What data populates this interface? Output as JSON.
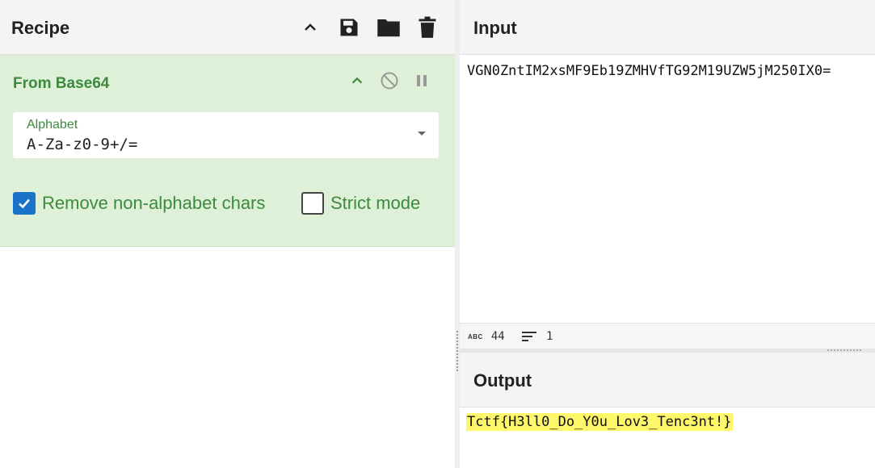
{
  "recipe": {
    "title": "Recipe",
    "buttons": {
      "collapse": "chevron-up-icon",
      "save": "save-icon",
      "load": "folder-icon",
      "clear": "trash-icon"
    }
  },
  "operation": {
    "title": "From Base64",
    "alphabet_label": "Alphabet",
    "alphabet_value": "A-Za-z0-9+/=",
    "remove_non_alphabet": {
      "label": "Remove non-alphabet chars",
      "checked": true
    },
    "strict_mode": {
      "label": "Strict mode",
      "checked": false
    }
  },
  "input": {
    "title": "Input",
    "text": "VGN0ZntIM2xsMF9Eb19ZMHVfTG92M19UZW5jM250IX0=",
    "length": "44",
    "lines": "1"
  },
  "output": {
    "title": "Output",
    "text": "Tctf{H3ll0_Do_Y0u_Lov3_Tenc3nt!}"
  },
  "colors": {
    "operation_bg": "#dff0d8",
    "operation_text": "#3c8a3c",
    "checkbox_on": "#1a73c9",
    "highlight": "#fff76a"
  }
}
